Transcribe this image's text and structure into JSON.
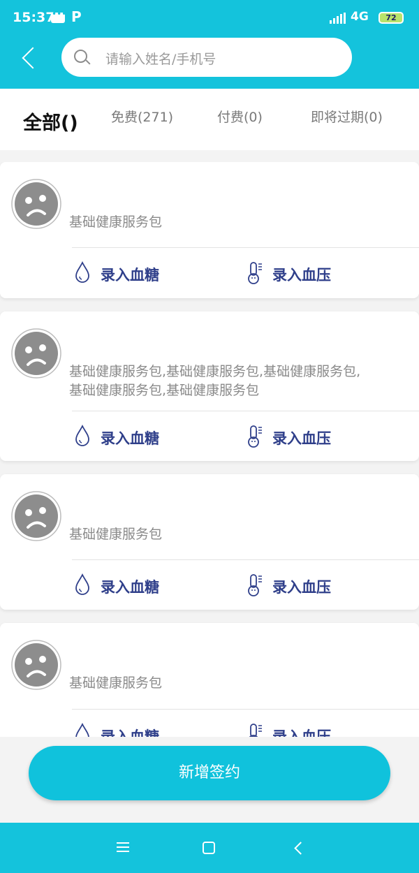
{
  "status_bar": {
    "time": "15:37",
    "network": "4G",
    "battery": "72"
  },
  "search": {
    "placeholder": "请输入姓名/手机号"
  },
  "tabs": [
    {
      "label": "全部()"
    },
    {
      "label": "免费(271)"
    },
    {
      "label": "付费(0)"
    },
    {
      "label": "即将过期(0)"
    }
  ],
  "cards": [
    {
      "service_line1": "基础健康服务包",
      "service_line2": "",
      "action_sugar": "录入血糖",
      "action_pressure": "录入血压"
    },
    {
      "service_line1": "基础健康服务包,基础健康服务包,基础健康服务包,",
      "service_line2": "基础健康服务包,基础健康服务包",
      "action_sugar": "录入血糖",
      "action_pressure": "录入血压"
    },
    {
      "service_line1": "基础健康服务包",
      "service_line2": "",
      "action_sugar": "录入血糖",
      "action_pressure": "录入血压"
    },
    {
      "service_line1": "基础健康服务包",
      "service_line2": "",
      "action_sugar": "录入血糖",
      "action_pressure": "录入血压"
    }
  ],
  "new_button": {
    "label": "新增签约"
  },
  "colors": {
    "accent": "#14c3dc",
    "action_text": "#2f3f8a"
  }
}
